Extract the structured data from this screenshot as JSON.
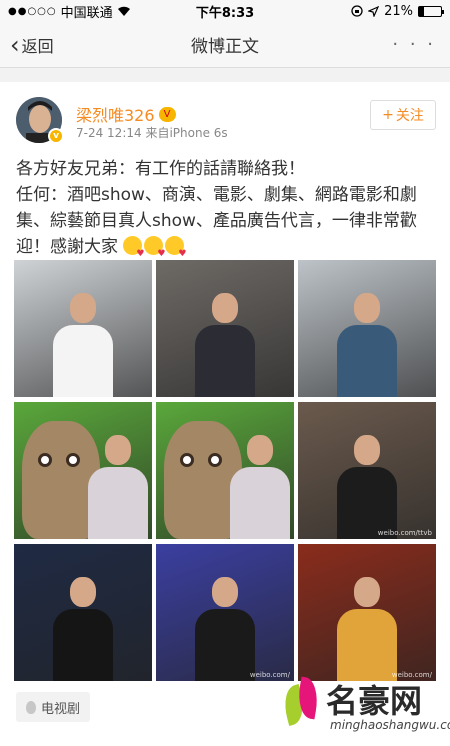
{
  "status_bar": {
    "signal_dots": "●●○○○",
    "carrier": "中国联通",
    "time": "下午8:33",
    "battery_percent": "21%",
    "battery_level": 0.21
  },
  "nav": {
    "back_label": "返回",
    "title": "微博正文",
    "more_label": "· · ·"
  },
  "post": {
    "username": "梁烈唯326",
    "vip_badge": "V",
    "verified_badge": "v",
    "meta": "7-24 12:14  来自iPhone 6s",
    "follow_label": "关注",
    "text_line1": "各方好友兄弟：有工作的話請聯絡我！",
    "text_line2": "任何：酒吧show、商演、電影、劇集、網路電影和劇集、綜藝節目真人show、產品廣告代言，一律非常歡迎！感謝大家",
    "tag_label": "电视剧"
  },
  "images": [
    {
      "name": "photo-1",
      "bg": "#cfd3d6",
      "body": "#f4f4f4",
      "wm": ""
    },
    {
      "name": "photo-2",
      "bg": "#6e6a66",
      "body": "#2c2c34",
      "wm": ""
    },
    {
      "name": "photo-3",
      "bg": "#bdc3c8",
      "body": "#3a5a7a",
      "wm": ""
    },
    {
      "name": "photo-4",
      "bg": "#5aa83b",
      "body": "#d9d2d8",
      "wm": ""
    },
    {
      "name": "photo-5",
      "bg": "#5aa83b",
      "body": "#d9d2d8",
      "wm": ""
    },
    {
      "name": "photo-6",
      "bg": "#6b5a4d",
      "body": "#1c1c1c",
      "wm": "weibo.com/ttvb"
    },
    {
      "name": "photo-7",
      "bg": "#1f2a44",
      "body": "#151515",
      "wm": ""
    },
    {
      "name": "photo-8",
      "bg": "#3b3fa0",
      "body": "#1a1a1a",
      "wm": "weibo.com/"
    },
    {
      "name": "photo-9",
      "bg": "#8a2c1c",
      "body": "#e0a43a",
      "wm": "weibo.com/"
    }
  ],
  "watermark_logo": {
    "name": "名豪网",
    "url": "minghaoshangwu.com"
  }
}
